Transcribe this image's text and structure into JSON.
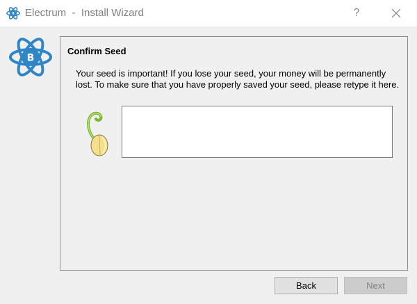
{
  "window": {
    "title": "Electrum  -  Install Wizard",
    "help_label": "?",
    "logo_icon": "electrum-logo-icon",
    "close_icon": "close-icon"
  },
  "page": {
    "heading": "Confirm Seed",
    "message": "Your seed is important! If you lose your seed, your money will be permanently lost. To make sure that you have properly saved your seed, please retype it here.",
    "seed_icon": "seed-icon",
    "seed_input_value": ""
  },
  "buttons": {
    "back_label": "Back",
    "next_label": "Next"
  },
  "colors": {
    "logo_blue": "#2f85c6",
    "disabled_button": "#cccccc"
  }
}
